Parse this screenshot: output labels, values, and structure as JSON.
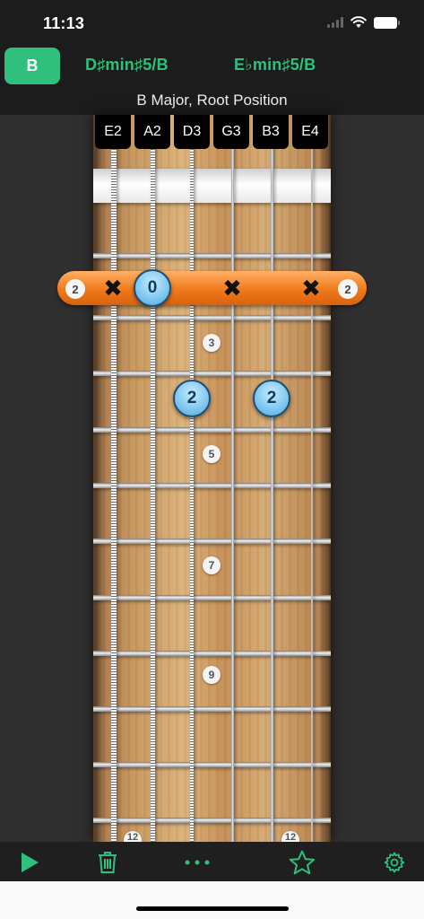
{
  "status": {
    "time": "11:13"
  },
  "header": {
    "selected_chord": "B",
    "alt_chords": [
      "D♯min♯5/B",
      "E♭min♯5/B"
    ],
    "chord_name": "B Major, Root Position"
  },
  "strings": [
    "E2",
    "A2",
    "D3",
    "G3",
    "B3",
    "E4"
  ],
  "capo": {
    "left_fret": "2",
    "right_fret": "2",
    "open_string": "0"
  },
  "fingers": [
    "2",
    "2"
  ],
  "fret_markers": [
    "3",
    "5",
    "7",
    "9",
    "12",
    "12"
  ],
  "toolbar": {
    "play_icon": "play-icon",
    "delete_icon": "trash-icon",
    "more_icon": "more-icon",
    "favorite_icon": "star-icon",
    "settings_icon": "gear-icon"
  },
  "colors": {
    "accent": "#2ec07c",
    "capo": "#f07a1c",
    "finger": "#7cc6ef"
  }
}
